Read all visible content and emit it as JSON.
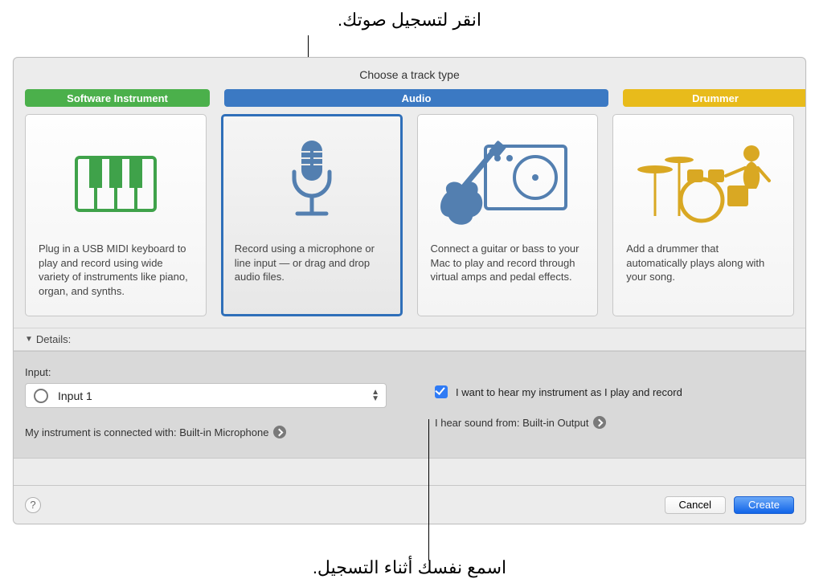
{
  "callouts": {
    "top": "انقر لتسجيل صوتك.",
    "bottom": "اسمع نفسك أثناء التسجيل."
  },
  "title": "Choose a track type",
  "categories": {
    "software": "Software Instrument",
    "audio": "Audio",
    "drummer": "Drummer"
  },
  "cards": {
    "software": "Plug in a USB MIDI keyboard to play and record using wide variety of instruments like piano, organ, and synths.",
    "mic": "Record using a microphone or line input — or drag and drop audio files.",
    "guitar": "Connect a guitar or bass to your Mac to play and record through virtual amps and pedal effects.",
    "drummer": "Add a drummer that automatically plays along with your song."
  },
  "details": {
    "label": "Details:",
    "input_label": "Input:",
    "input_value": "Input 1",
    "instrument_conn": "My instrument is connected with: Built-in Microphone",
    "monitor_check": "I want to hear my instrument as I play and record",
    "output_line": "I hear sound from: Built-in Output"
  },
  "footer": {
    "help": "?",
    "cancel": "Cancel",
    "create": "Create"
  }
}
